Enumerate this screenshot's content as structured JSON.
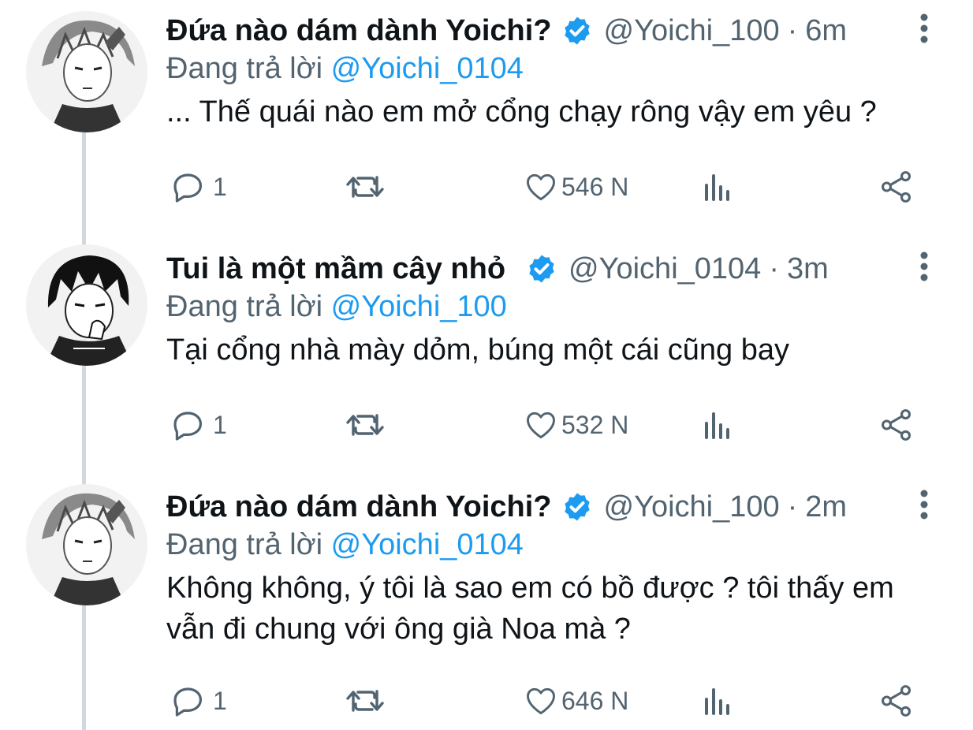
{
  "tweets": [
    {
      "name": "Đứa nào dám dành Yoichi?",
      "handle": "@Yoichi_100",
      "separator": "·",
      "time": "6m",
      "reply_prefix": "Đang trả lời",
      "reply_to": "@Yoichi_0104",
      "text": "... Thế quái nào em mở cổng chạy rông vậy em yêu ?",
      "replies": "1",
      "likes": "546 N"
    },
    {
      "name": "Tui là một mầm cây nhỏ",
      "handle": "@Yoichi_0104",
      "separator": "·",
      "time": "3m",
      "reply_prefix": "Đang trả lời",
      "reply_to": "@Yoichi_100",
      "text": "Tại cổng nhà mày dỏm, búng một cái cũng bay",
      "replies": "1",
      "likes": "532 N"
    },
    {
      "name": "Đứa nào dám dành Yoichi?",
      "handle": "@Yoichi_100",
      "separator": "·",
      "time": "2m",
      "reply_prefix": "Đang trả lời",
      "reply_to": "@Yoichi_0104",
      "text": "Không không, ý tôi là sao em có bồ được ? tôi thấy em vẫn đi chung với ông già Noa mà ?",
      "replies": "1",
      "likes": "646 N"
    }
  ],
  "icons": {
    "reply": "reply-icon",
    "retweet": "retweet-icon",
    "like": "heart-icon",
    "views": "views-icon",
    "share": "share-icon",
    "verified": "verified-badge-icon",
    "more": "more-options-icon"
  },
  "colors": {
    "name": "#0f1419",
    "secondary": "#536471",
    "mention": "#1d9bf0",
    "verified": "#1d9bf0",
    "thread_line": "#cfd9de"
  }
}
